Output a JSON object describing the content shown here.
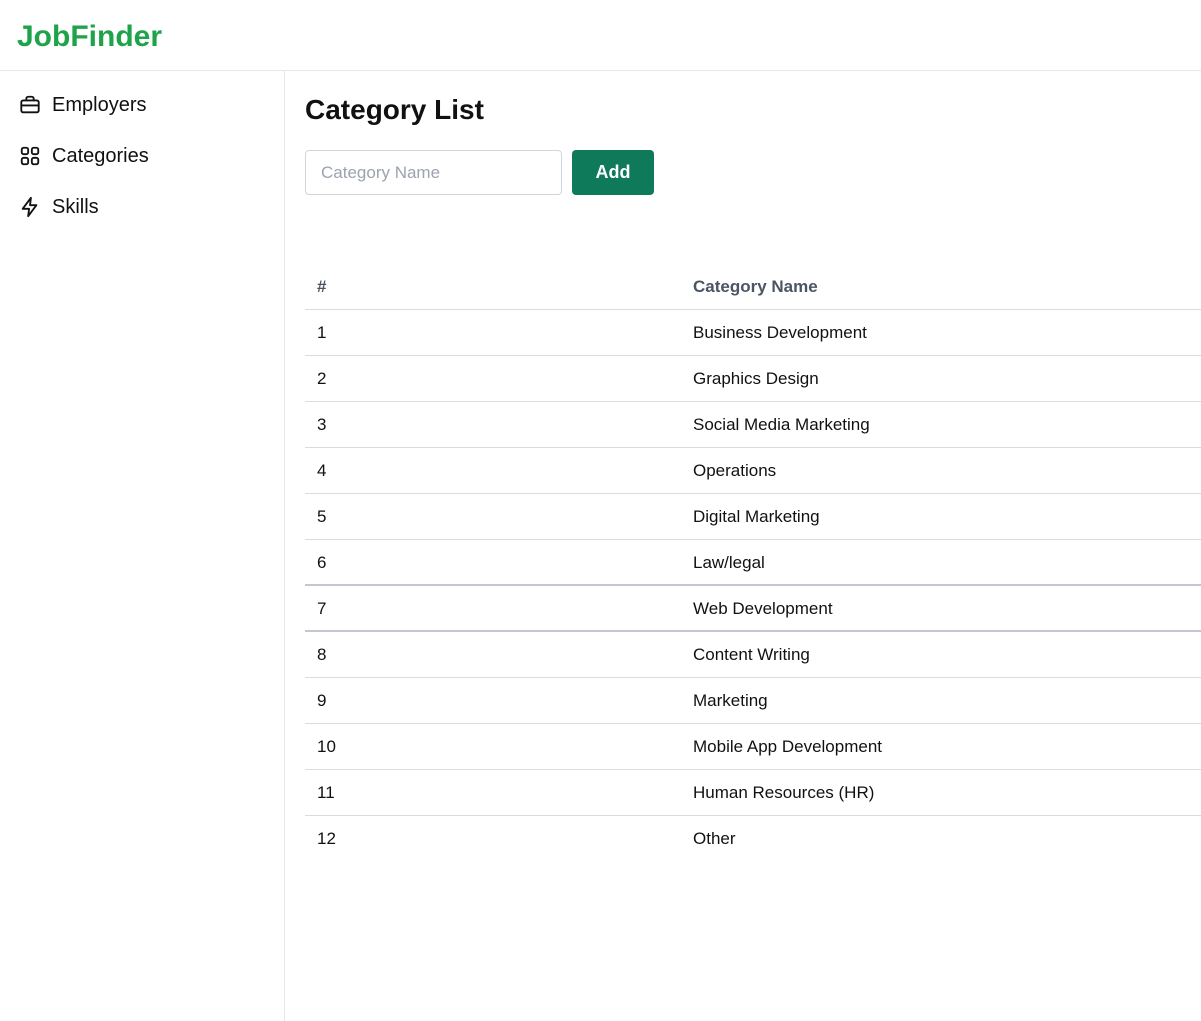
{
  "app": {
    "brand": "JobFinder",
    "brand_color": "#1fa34a"
  },
  "sidebar": {
    "items": [
      {
        "label": "Employers",
        "icon": "briefcase-icon"
      },
      {
        "label": "Categories",
        "icon": "grid-icon"
      },
      {
        "label": "Skills",
        "icon": "lightning-icon"
      }
    ]
  },
  "main": {
    "title": "Category List",
    "input": {
      "value": "",
      "placeholder": "Category Name"
    },
    "add_label": "Add",
    "add_color": "#0f7a5a",
    "table": {
      "headers": [
        "#",
        "Category Name"
      ],
      "rows": [
        {
          "num": "1",
          "name": "Business Development"
        },
        {
          "num": "2",
          "name": "Graphics Design"
        },
        {
          "num": "3",
          "name": "Social Media Marketing"
        },
        {
          "num": "4",
          "name": "Operations"
        },
        {
          "num": "5",
          "name": "Digital Marketing"
        },
        {
          "num": "6",
          "name": "Law/legal"
        },
        {
          "num": "7",
          "name": "Web Development"
        },
        {
          "num": "8",
          "name": "Content Writing"
        },
        {
          "num": "9",
          "name": "Marketing"
        },
        {
          "num": "10",
          "name": "Mobile App Development"
        },
        {
          "num": "11",
          "name": "Human Resources (HR)"
        },
        {
          "num": "12",
          "name": "Other"
        }
      ]
    }
  }
}
